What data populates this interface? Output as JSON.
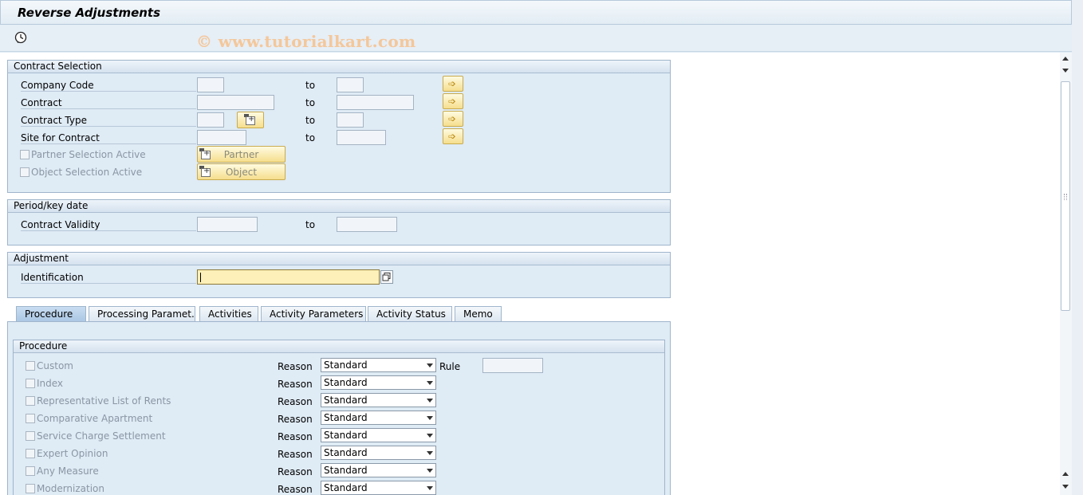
{
  "title": "Reverse Adjustments",
  "watermark": "© www.tutorialkart.com",
  "contract_selection": {
    "header": "Contract Selection",
    "to_label": "to",
    "rows": [
      {
        "label": "Company Code",
        "from": "",
        "to": ""
      },
      {
        "label": "Contract",
        "from": "",
        "to": ""
      },
      {
        "label": "Contract Type",
        "from": "",
        "to": ""
      },
      {
        "label": "Site for Contract",
        "from": "",
        "to": ""
      }
    ],
    "partner_checkbox": "Partner Selection Active",
    "object_checkbox": "Object Selection Active",
    "partner_button": "Partner",
    "object_button": "Object"
  },
  "period": {
    "header": "Period/key date",
    "label": "Contract Validity",
    "to_label": "to"
  },
  "adjustment": {
    "header": "Adjustment",
    "label": "Identification",
    "value": ""
  },
  "tabs": [
    "Procedure",
    "Processing Paramet.",
    "Activities",
    "Activity Parameters",
    "Activity Status",
    "Memo"
  ],
  "procedure": {
    "header": "Procedure",
    "reason_label": "Reason",
    "rule_label": "Rule",
    "items": [
      {
        "label": "Custom",
        "reason": "Standard"
      },
      {
        "label": "Index",
        "reason": "Standard"
      },
      {
        "label": "Representative List of Rents",
        "reason": "Standard"
      },
      {
        "label": "Comparative Apartment",
        "reason": "Standard"
      },
      {
        "label": "Service Charge Settlement",
        "reason": "Standard"
      },
      {
        "label": "Expert Opinion",
        "reason": "Standard"
      },
      {
        "label": "Any Measure",
        "reason": "Standard"
      },
      {
        "label": "Modernization",
        "reason": "Standard"
      }
    ]
  },
  "icons": {
    "execute": "execute-clock-icon",
    "arrow": "multiple-selection-arrow-icon"
  }
}
